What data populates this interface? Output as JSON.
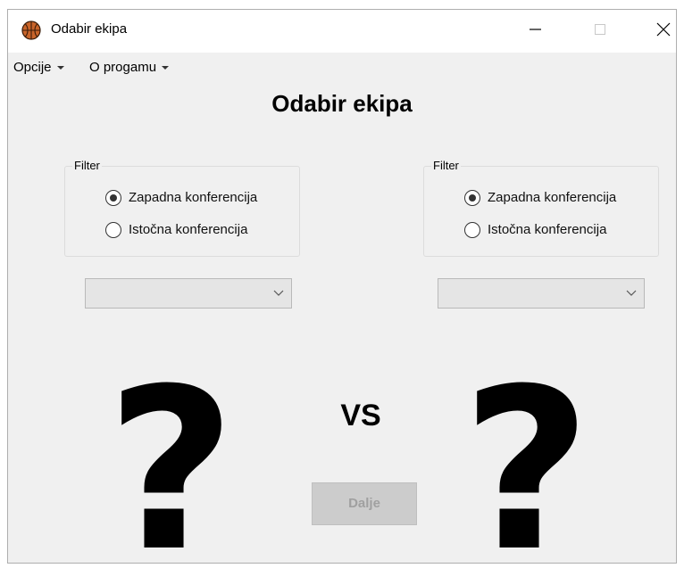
{
  "window": {
    "title": "Odabir ekipa",
    "app_icon": "basketball-icon",
    "controls": [
      "minimize-icon",
      "maximize-icon",
      "close-icon"
    ]
  },
  "menu": {
    "items": [
      {
        "label": "Opcije"
      },
      {
        "label": "O progamu"
      }
    ]
  },
  "main": {
    "heading": "Odabir ekipa",
    "left_team": {
      "filter_label": "Filter",
      "options": [
        {
          "label": "Zapadna konferencija",
          "checked": true
        },
        {
          "label": "Istočna konferencija",
          "checked": false
        }
      ],
      "selected_team": "",
      "placeholder_symbol": "?"
    },
    "right_team": {
      "filter_label": "Filter",
      "options": [
        {
          "label": "Zapadna konferencija",
          "checked": true
        },
        {
          "label": "Istočna konferencija",
          "checked": false
        }
      ],
      "selected_team": "",
      "placeholder_symbol": "?"
    },
    "versus_label": "VS",
    "next_button": {
      "label": "Dalje",
      "enabled": false
    }
  },
  "colors": {
    "window_bg": "#f0f0f0",
    "titlebar_bg": "#ffffff",
    "basketball": "#d2691e",
    "disabled_button_bg": "#cccccc",
    "disabled_button_text": "#a0a0a0"
  }
}
